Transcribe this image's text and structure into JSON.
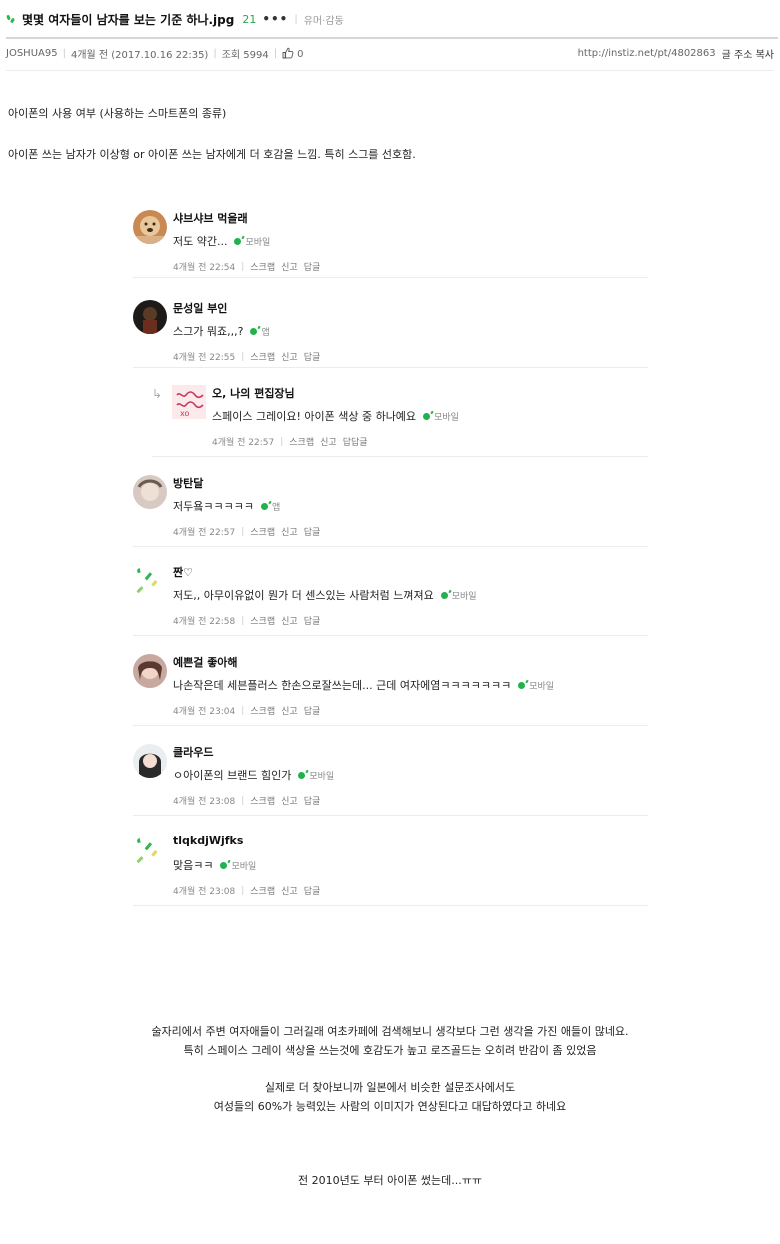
{
  "post": {
    "title": "몇몇 여자들이 남자를 보는 기준 하나.jpg",
    "comment_count": "21",
    "more": "•••",
    "category": "유머·감동",
    "author": "JOSHUA95",
    "time": "4개월 전 (2017.10.16 22:35)",
    "views": "조회 5994",
    "likes": "0",
    "url": "http://instiz.net/pt/4802863",
    "copy_label": "글 주소 복사",
    "body": [
      "아이폰의 사용 여부 (사용하는 스마트폰의 종류)",
      "아이폰 쓰는 남자가 이상형 or 아이폰 쓰는 남자에게 더 호감을 느낌. 특히 스그를 선호함."
    ]
  },
  "comments": [
    {
      "author": "샤브샤브 먹을래",
      "text": "저도 약간...",
      "device": "모바일",
      "time": "4개월 전 22:54",
      "actions": [
        "스크랩",
        "신고",
        "답글"
      ]
    },
    {
      "author": "문성일 부인",
      "text": "스그가 뭐죠,,,?",
      "device": "앱",
      "time": "4개월 전 22:55",
      "actions": [
        "스크랩",
        "신고",
        "답글"
      ]
    },
    {
      "author": "오, 나의 편집장님",
      "text": "스페이스 그레이요! 아이폰 색상 중 하나예요",
      "device": "모바일",
      "time": "4개월 전 22:57",
      "actions": [
        "스크랩",
        "신고",
        "답답글"
      ]
    },
    {
      "author": "방탄달",
      "text": "저두욬ㅋㅋㅋㅋㅋ",
      "device": "앱",
      "time": "4개월 전 22:57",
      "actions": [
        "스크랩",
        "신고",
        "답글"
      ]
    },
    {
      "author": "짠♡",
      "text": "저도,, 아무이유없이 뭔가 더 센스있는 사람처럼 느껴져요",
      "device": "모바일",
      "time": "4개월 전 22:58",
      "actions": [
        "스크랩",
        "신고",
        "답글"
      ]
    },
    {
      "author": "예쁜걸 좋아해",
      "text": "나손작은데 세븐플러스 한손으로잘쓰는데... 근데 여자에염ㅋㅋㅋㅋㅋㅋㅋ",
      "device": "모바일",
      "time": "4개월 전 23:04",
      "actions": [
        "스크랩",
        "신고",
        "답글"
      ]
    },
    {
      "author": "클라우드",
      "text": "ㅇ아이폰의 브랜드 힘인가",
      "device": "모바일",
      "time": "4개월 전 23:08",
      "actions": [
        "스크랩",
        "신고",
        "답글"
      ]
    },
    {
      "author": "tlqkdjWjfks",
      "text": "맞음ㅋㅋ",
      "device": "모바일",
      "time": "4개월 전 23:08",
      "actions": [
        "스크랩",
        "신고",
        "답글"
      ]
    }
  ],
  "tail": [
    "술자리에서 주변 여자애들이 그러길래 여초카페에 검색해보니 생각보다 그런 생각을 가진 애들이 많네요.",
    "특히 스페이스 그레이 색상을 쓰는것에 호감도가 높고 로즈골드는 오히려 반감이 좀 있었음",
    "실제로 더 찾아보니까 일본에서 비슷한 설문조사에서도",
    "여성들의 60%가 능력있는 사람의 이미지가 연상된다고 대답하였다고 하네요",
    "전 2010년도 부터 아이폰 썼는데...ㅠㅠ"
  ]
}
